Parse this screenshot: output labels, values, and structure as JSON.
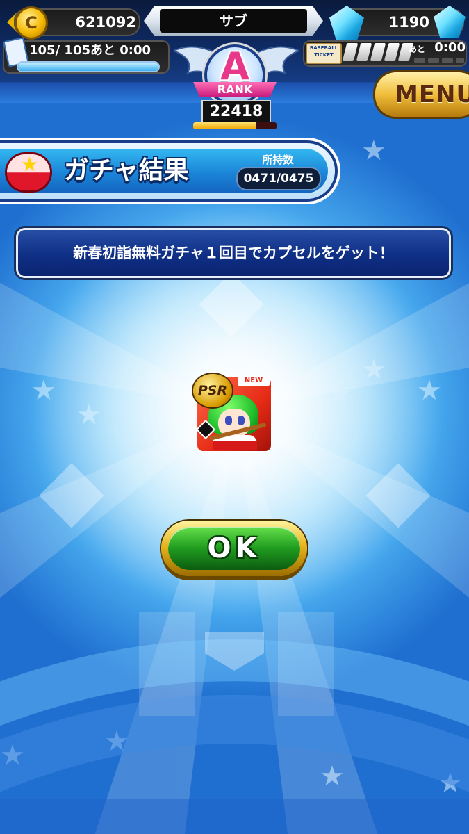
{
  "header": {
    "coins": "621092",
    "team_name": "サブ",
    "gems": "1190",
    "stamina_text": "105/ 105あと 0:00",
    "stamina_fraction": 1.0,
    "ticket_label": "BASEBALL TICKET",
    "ticket_ato": "あと",
    "ticket_time": "0:00",
    "rank_letter": "A",
    "rank_word": "RANK",
    "rank_score": "22418",
    "rank_progress_fraction": 0.75,
    "menu_label": "MENU"
  },
  "title_bar": {
    "title": "ガチャ結果",
    "owned_label": "所持数",
    "owned_value": "0471/0475"
  },
  "message": "新春初詣無料ガチャ１回目でカプセルをゲット！",
  "result_card": {
    "rarity": "PSR",
    "badge": "NEW"
  },
  "ok_label": "OK",
  "colors": {
    "accent_blue": "#1b85d8",
    "ok_green": "#1f9b1f",
    "gold": "#e7b51e",
    "rank_pink": "#e8388a"
  },
  "icons": [
    "coin-icon",
    "gem-icon",
    "stamina-icon",
    "ticket-icon",
    "capsule-icon",
    "back-arrow-icon"
  ]
}
